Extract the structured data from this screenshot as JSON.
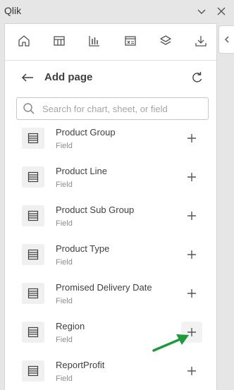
{
  "app": {
    "title": "Qlik"
  },
  "add_page": {
    "title": "Add page",
    "search_placeholder": "Search for chart, sheet, or field"
  },
  "items": [
    {
      "name": "Product Group",
      "type": "Field"
    },
    {
      "name": "Product Line",
      "type": "Field"
    },
    {
      "name": "Product Sub Group",
      "type": "Field"
    },
    {
      "name": "Product Type",
      "type": "Field"
    },
    {
      "name": "Promised Delivery Date",
      "type": "Field"
    },
    {
      "name": "Region",
      "type": "Field"
    },
    {
      "name": "ReportProfit",
      "type": "Field"
    }
  ],
  "colors": {
    "accent_arrow": "#1e9a3c",
    "panel_bg": "#ffffff",
    "window_bg": "#e6e6e6"
  }
}
